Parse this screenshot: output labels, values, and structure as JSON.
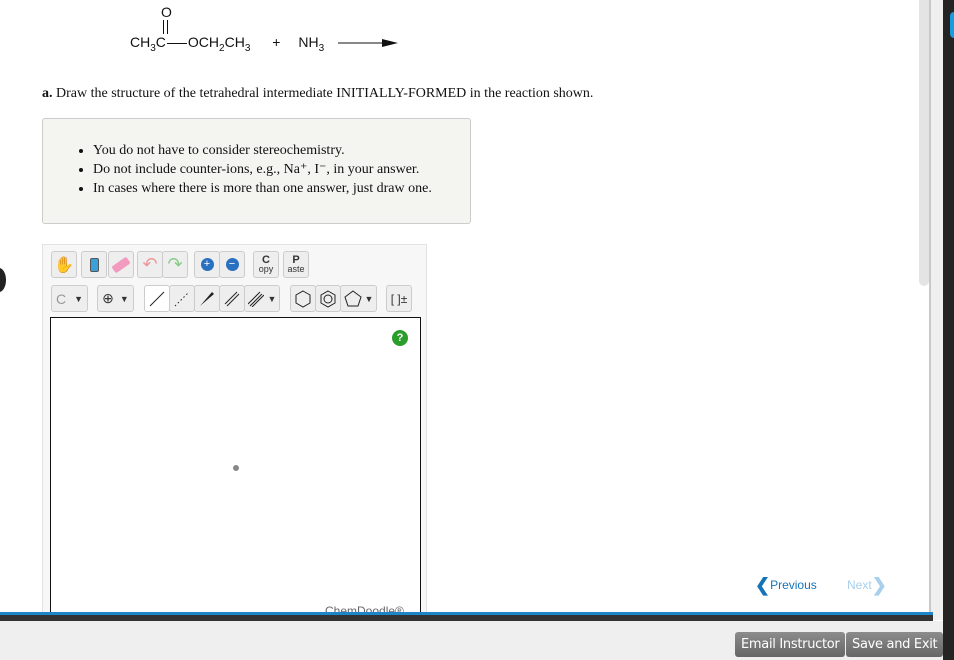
{
  "reaction": {
    "oxygen": "O",
    "ester_left": "CH",
    "s3": "3",
    "c": "C",
    "ester_right": "OCH",
    "s2": "2",
    "ch": "CH",
    "plus": "+",
    "nh": "NH"
  },
  "question": "a. Draw the structure of the tetrahedral intermediate INITIALLY-FORMED in the reaction shown.",
  "hints": [
    "You do not have to consider stereochemistry.",
    "Do not include counter-ions, e.g., Na⁺, I⁻, in your answer.",
    "In cases where there is more than one answer, just draw one."
  ],
  "toolbar": {
    "copy": "C",
    "copy_sub": "opy",
    "paste": "P",
    "paste_sub": "aste",
    "atom": "C",
    "charge": "⊕",
    "bracket": "[ ]±",
    "help": "?"
  },
  "brand": "ChemDoodle®",
  "nav": {
    "previous": "Previous",
    "next": "Next"
  },
  "footer": {
    "email": "Email Instructor",
    "save": "Save and Exit"
  },
  "colors": {
    "nav_active": "#1673b8",
    "nav_disabled": "#a8d0ec",
    "accent_bar": "#1c86c8"
  }
}
